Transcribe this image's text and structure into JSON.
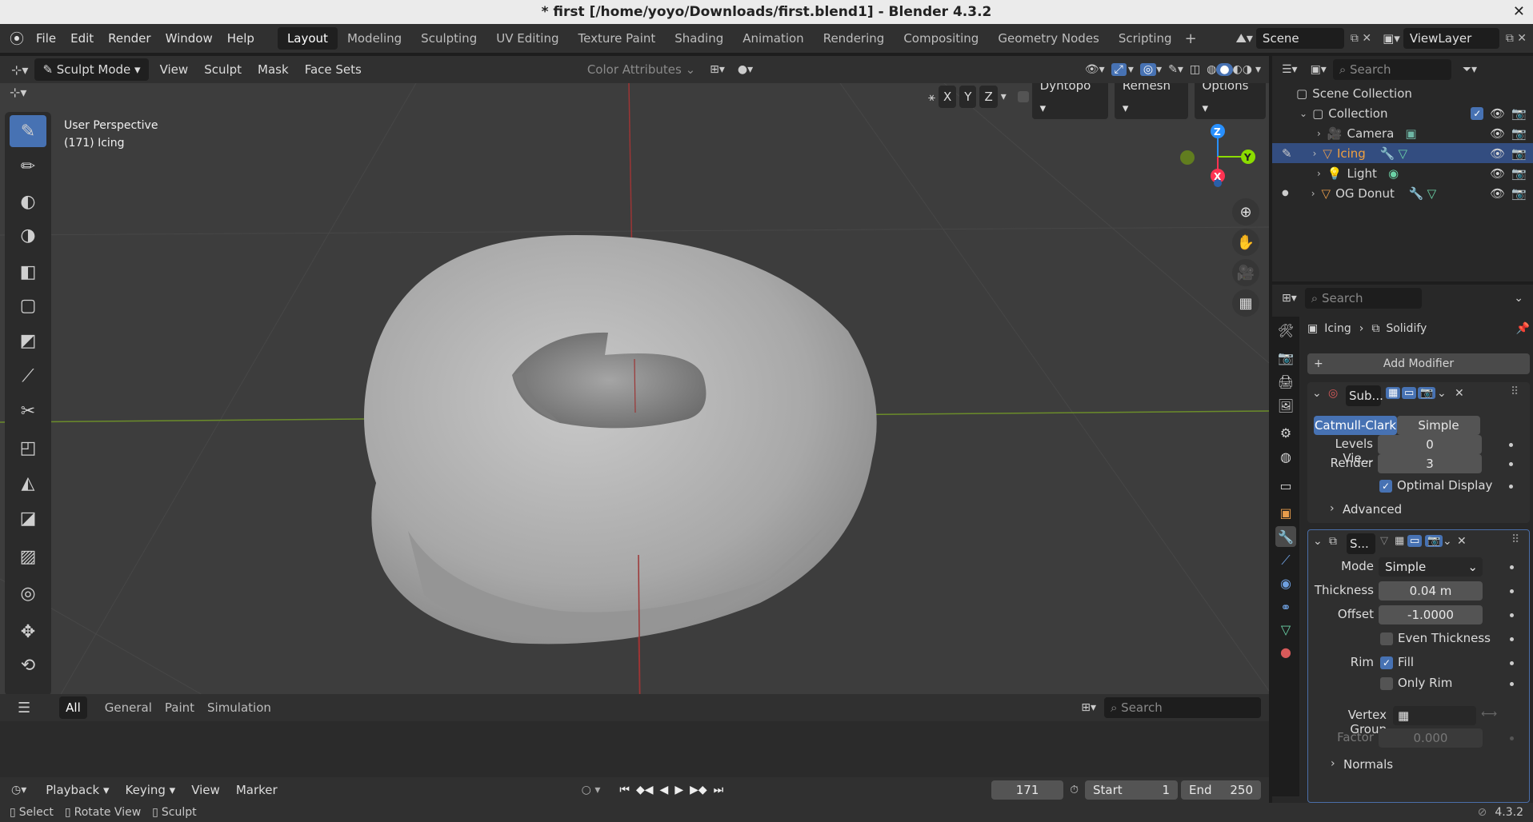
{
  "title": "* first [/home/yoyo/Downloads/first.blend1] - Blender 4.3.2",
  "menu": [
    "File",
    "Edit",
    "Render",
    "Window",
    "Help"
  ],
  "workspaces": [
    "Layout",
    "Modeling",
    "Sculpting",
    "UV Editing",
    "Texture Paint",
    "Shading",
    "Animation",
    "Rendering",
    "Compositing",
    "Geometry Nodes",
    "Scripting"
  ],
  "active_workspace": "Layout",
  "scene": "Scene",
  "view_layer": "ViewLayer",
  "viewport_header": {
    "mode": "Sculpt Mode",
    "menus": [
      "View",
      "Sculpt",
      "Mask",
      "Face Sets"
    ],
    "color_attributes": "Color Attributes"
  },
  "sculpt_header": {
    "x": "X",
    "y": "Y",
    "z": "Z",
    "dyntopo": "Dyntopo",
    "remesh": "Remesh",
    "options": "Options"
  },
  "viewport_info": {
    "perspective": "User Perspective",
    "object": "(171) Icing"
  },
  "gizmo": {
    "x": "X",
    "y": "Y",
    "z": "Z"
  },
  "asset_tabs": [
    "All",
    "General",
    "Paint",
    "Simulation"
  ],
  "asset_search_placeholder": "Search",
  "timeline": {
    "menus": [
      "Playback",
      "Keying",
      "View",
      "Marker"
    ],
    "frame": "171",
    "start_label": "Start",
    "start": "1",
    "end_label": "End",
    "end": "250"
  },
  "status": {
    "select": "Select",
    "rotate": "Rotate View",
    "sculpt": "Sculpt",
    "version": "4.3.2"
  },
  "outliner": {
    "search_placeholder": "Search",
    "scene_collection": "Scene Collection",
    "collection": "Collection",
    "items": [
      "Camera",
      "Icing",
      "Light",
      "OG Donut"
    ]
  },
  "properties": {
    "search_placeholder": "Search",
    "breadcrumb_object": "Icing",
    "breadcrumb_modifier": "Solidify",
    "add_modifier": "Add Modifier",
    "subsurf": {
      "name": "Sub...",
      "catmull": "Catmull-Clark",
      "simple": "Simple",
      "levels_label": "Levels Vie...",
      "levels": "0",
      "render_label": "Render",
      "render": "3",
      "optimal": "Optimal Display",
      "advanced": "Advanced"
    },
    "solidify": {
      "name": "S...",
      "mode_label": "Mode",
      "mode": "Simple",
      "thickness_label": "Thickness",
      "thickness": "0.04 m",
      "offset_label": "Offset",
      "offset": "-1.0000",
      "even": "Even Thickness",
      "rim_label": "Rim",
      "fill": "Fill",
      "only_rim": "Only Rim",
      "vgroup_label": "Vertex Group",
      "factor_label": "Factor",
      "factor": "0.000",
      "normals": "Normals"
    }
  },
  "colors": {
    "accent": "#4772b3",
    "axis_x": "#ff3352",
    "axis_y": "#8bdc00",
    "axis_z": "#2890ff"
  }
}
